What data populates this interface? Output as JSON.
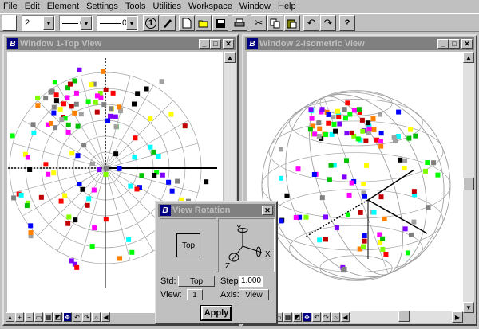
{
  "menu": [
    {
      "label": "File",
      "u": "F",
      "rest": "ile"
    },
    {
      "label": "Edit",
      "u": "E",
      "rest": "dit"
    },
    {
      "label": "Element",
      "u": "E",
      "rest": "lement"
    },
    {
      "label": "Settings",
      "u": "S",
      "rest": "ettings"
    },
    {
      "label": "Tools",
      "u": "T",
      "rest": "ools"
    },
    {
      "label": "Utilities",
      "u": "U",
      "rest": "tilities"
    },
    {
      "label": "Workspace",
      "u": "W",
      "rest": "orkspace"
    },
    {
      "label": "Window",
      "u": "W",
      "rest": "indow"
    },
    {
      "label": "Help",
      "u": "H",
      "rest": "elp"
    }
  ],
  "toolbar": {
    "weight_value": "2",
    "style_value": "0",
    "lineweight_value": "0",
    "keypoint_label": "1",
    "help_label": "?"
  },
  "window1": {
    "title": "Window 1-Top View"
  },
  "window2": {
    "title": "Window 2-Isometric View"
  },
  "dialog": {
    "title": "View Rotation",
    "preview_label": "Top",
    "std_label": "Std:",
    "std_value": "Top",
    "view_label": "View:",
    "view_value": "1",
    "step_label": "Step:",
    "step_value": "1.000",
    "axis_label": "Axis:",
    "axis_value": "View",
    "apply_label": "Apply",
    "axis_y": "Y",
    "axis_x": "X",
    "axis_z": "Z"
  },
  "colors": {
    "title_inactive": "#808080",
    "title_text": "#c0c0c0",
    "dialog_title": "#808080"
  }
}
